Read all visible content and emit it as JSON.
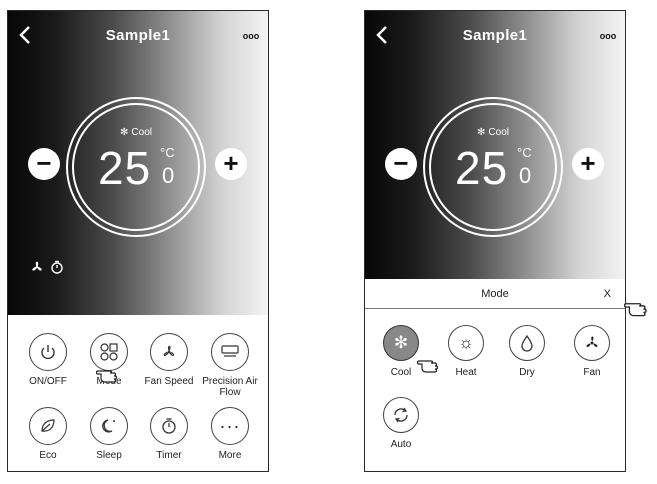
{
  "left_screen": {
    "title": "Sample1",
    "back_icon": "chevron-left-icon",
    "more_icon": "ooo",
    "mode": "Cool",
    "temperature_int": "25",
    "temperature_unit": "°C",
    "temperature_decimal": "0",
    "minus_label": "−",
    "plus_label": "+",
    "buttons": [
      {
        "label": "ON/OFF",
        "icon": "power-icon"
      },
      {
        "label": "Mode",
        "icon": "mode-icon"
      },
      {
        "label": "Fan Speed",
        "icon": "fan-icon"
      },
      {
        "label": "Precision Air Flow",
        "icon": "airflow-icon"
      },
      {
        "label": "Eco",
        "icon": "leaf-icon"
      },
      {
        "label": "Sleep",
        "icon": "moon-icon"
      },
      {
        "label": "Timer",
        "icon": "timer-icon"
      },
      {
        "label": "More",
        "icon": "more-icon"
      }
    ]
  },
  "right_screen": {
    "title": "Sample1",
    "more_icon": "ooo",
    "mode": "Cool",
    "temperature_int": "25",
    "temperature_unit": "°C",
    "temperature_decimal": "0",
    "minus_label": "−",
    "plus_label": "+",
    "panel": {
      "title": "Mode",
      "close_label": "X",
      "options": [
        {
          "label": "Cool",
          "icon": "snowflake-icon",
          "selected": true
        },
        {
          "label": "Heat",
          "icon": "sun-icon",
          "selected": false
        },
        {
          "label": "Dry",
          "icon": "droplet-icon",
          "selected": false
        },
        {
          "label": "Fan",
          "icon": "fan-icon",
          "selected": false
        },
        {
          "label": "Auto",
          "icon": "auto-icon",
          "selected": false
        }
      ]
    }
  },
  "colors": {
    "hero_dark": "#070707",
    "hero_light": "#f4f4f4",
    "selected_mode": "#888888"
  }
}
